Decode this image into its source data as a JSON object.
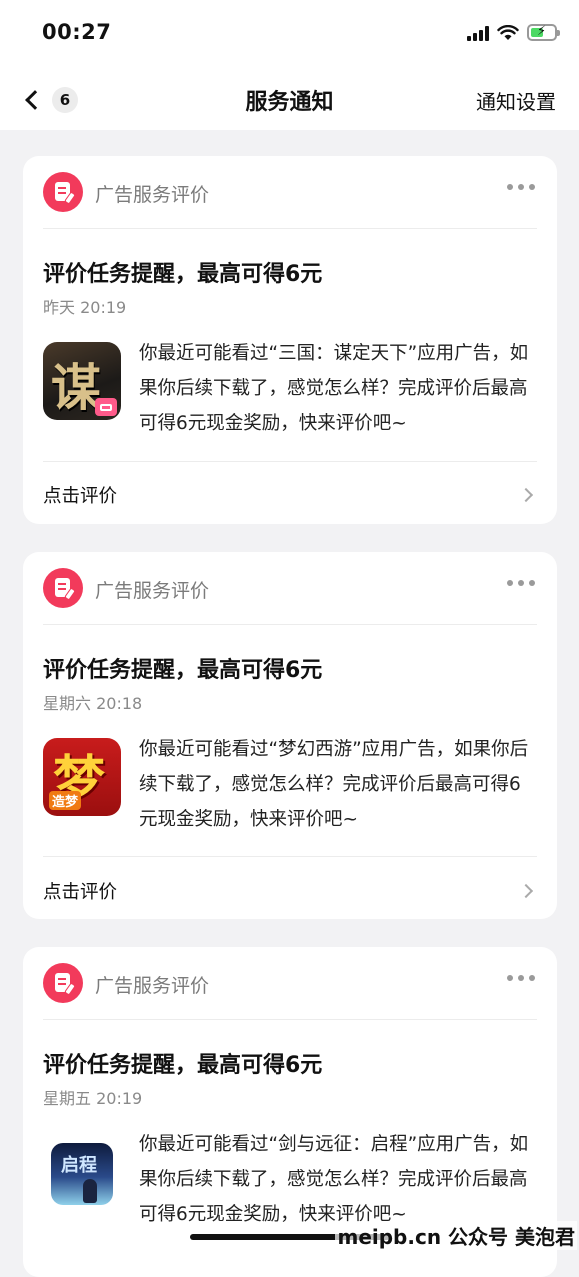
{
  "status_bar": {
    "time": "00:27"
  },
  "nav": {
    "badge": "6",
    "title": "服务通知",
    "settings_label": "通知设置"
  },
  "notifications": [
    {
      "service": "广告服务评价",
      "title": "评价任务提醒，最高可得6元",
      "time": "昨天 20:19",
      "app_thumb_text": "谋",
      "body": "你最近可能看过“三国：谋定天下”应用广告，如果你后续下载了，感觉怎么样？完成评价后最高可得6元现金奖励，快来评价吧~",
      "action": "点击评价"
    },
    {
      "service": "广告服务评价",
      "title": "评价任务提醒，最高可得6元",
      "time": "星期六 20:18",
      "app_thumb_text": "梦",
      "app_thumb_tag": "造梦",
      "body": "你最近可能看过“梦幻西游”应用广告，如果你后续下载了，感觉怎么样？完成评价后最高可得6元现金奖励，快来评价吧~",
      "action": "点击评价"
    },
    {
      "service": "广告服务评价",
      "title": "评价任务提醒，最高可得6元",
      "time": "星期五 20:19",
      "app_thumb_text": "启程",
      "body": "你最近可能看过“剑与远征：启程”应用广告，如果你后续下载了，感觉怎么样？完成评价后最高可得6元现金奖励，快来评价吧~",
      "action": "点击评价"
    }
  ],
  "watermark": "meipb.cn 公众号 美泡君",
  "colors": {
    "accent": "#f23a5b",
    "background": "#f2f2f4"
  }
}
